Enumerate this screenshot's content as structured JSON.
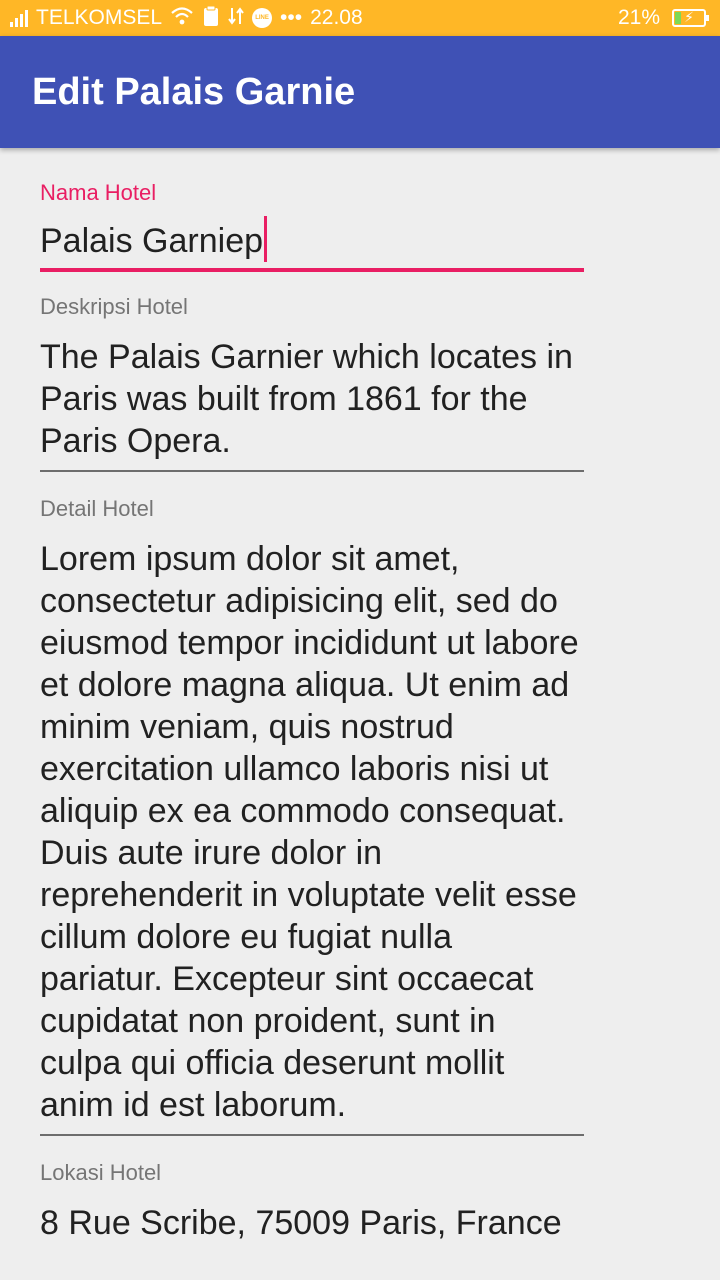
{
  "status_bar": {
    "carrier": "TELKOMSEL",
    "dots": "•••",
    "time": "22.08",
    "battery_percent": "21%",
    "battery_level": 0.21,
    "line_badge": "LINE"
  },
  "app_bar": {
    "title": "Edit Palais Garnie"
  },
  "form": {
    "nama": {
      "label": "Nama Hotel",
      "value": "Palais Garniep"
    },
    "deskripsi": {
      "label": "Deskripsi Hotel",
      "value": "The Palais Garnier which locates in Paris was built from 1861 for the Paris Opera."
    },
    "detail": {
      "label": "Detail Hotel",
      "value": "Lorem ipsum dolor sit amet, consectetur adipisicing elit, sed do eiusmod tempor incididunt ut labore et dolore magna aliqua. Ut enim ad minim veniam, quis nostrud exercitation ullamco laboris nisi ut aliquip ex ea commodo consequat. Duis aute irure dolor in reprehenderit in voluptate velit esse cillum dolore eu fugiat nulla pariatur. Excepteur sint occaecat cupidatat non proident, sunt in culpa qui officia deserunt mollit anim id est laborum."
    },
    "lokasi": {
      "label": "Lokasi Hotel",
      "value": "8 Rue Scribe, 75009 Paris, France"
    }
  },
  "colors": {
    "status_bar": "#ffb726",
    "app_bar": "#3f51b5",
    "accent": "#e91e63",
    "background": "#eeeeee"
  }
}
